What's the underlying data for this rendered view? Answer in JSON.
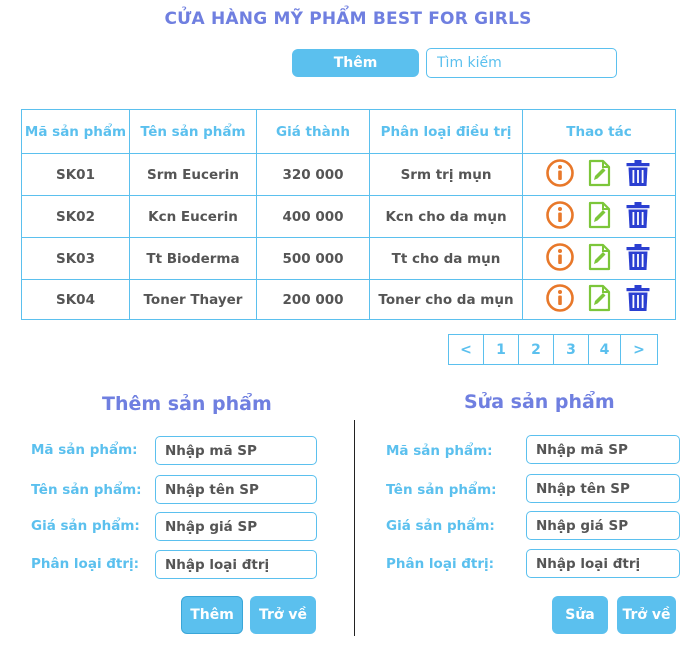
{
  "page": {
    "title": "CỬA HÀNG MỸ PHẨM BEST FOR GIRLS"
  },
  "toolbar": {
    "add_label": "Thêm",
    "search_placeholder": "Tìm kiếm"
  },
  "table": {
    "headers": [
      "Mã sản phẩm",
      "Tên sản phẩm",
      "Giá thành",
      "Phân loại điều trị",
      "Thao tác"
    ],
    "rows": [
      {
        "code": "SK01",
        "name": "Srm Eucerin",
        "price": "320 000",
        "category": "Srm trị mụn"
      },
      {
        "code": "SK02",
        "name": "Kcn Eucerin",
        "price": "400 000",
        "category": "Kcn cho da mụn"
      },
      {
        "code": "SK03",
        "name": "Tt Bioderma",
        "price": "500 000",
        "category": "Tt cho da mụn"
      },
      {
        "code": "SK04",
        "name": "Toner Thayer",
        "price": "200 000",
        "category": "Toner cho da mụn"
      }
    ],
    "action_icons": [
      "info-icon",
      "edit-icon",
      "trash-icon"
    ]
  },
  "pagination": {
    "prev": "<",
    "pages": [
      "1",
      "2",
      "3",
      "4"
    ],
    "next": ">"
  },
  "add_form": {
    "title": "Thêm sản phẩm",
    "fields": [
      {
        "label": "Mã sản phẩm:",
        "placeholder": "Nhập mã SP"
      },
      {
        "label": "Tên sản phẩm:",
        "placeholder": "Nhập tên SP"
      },
      {
        "label": "Giá sản phẩm:",
        "placeholder": "Nhập giá SP"
      },
      {
        "label": "Phân loại đtrị:",
        "placeholder": "Nhập loại đtrị"
      }
    ],
    "submit_label": "Thêm",
    "back_label": "Trở về"
  },
  "edit_form": {
    "title": "Sửa sản phẩm",
    "fields": [
      {
        "label": "Mã sản phẩm:",
        "placeholder": "Nhập mã SP"
      },
      {
        "label": "Tên sản phẩm:",
        "placeholder": "Nhập tên SP"
      },
      {
        "label": "Giá sản phẩm:",
        "placeholder": "Nhập giá SP"
      },
      {
        "label": "Phân loại đtrị:",
        "placeholder": "Nhập loại đtrị"
      }
    ],
    "submit_label": "Sửa",
    "back_label": "Trở về"
  },
  "colors": {
    "accent": "#5bc0ee",
    "title": "#6f7fe0",
    "info_icon": "#e8782a",
    "edit_icon": "#7cc63a",
    "trash_icon": "#2b3fd1"
  }
}
